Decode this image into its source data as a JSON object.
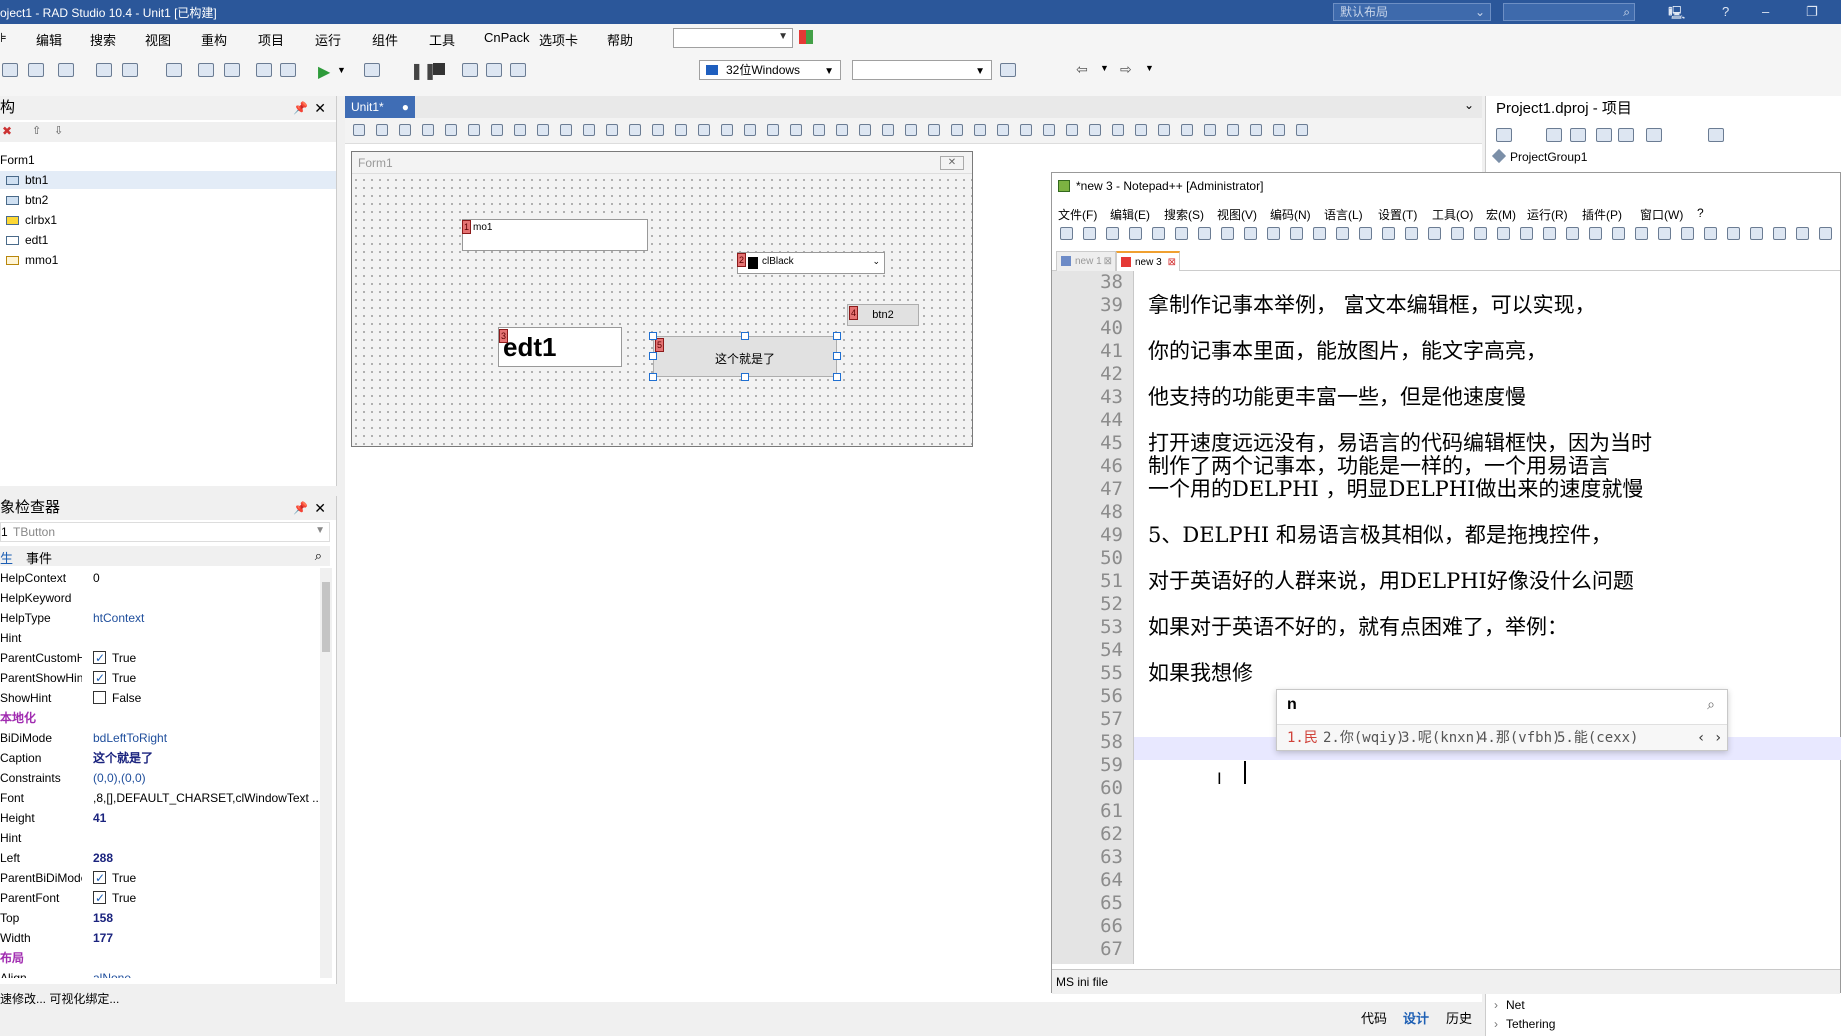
{
  "window": {
    "title": "oject1 - RAD Studio 10.4 - Unit1 [已构建]",
    "layout_label": "默认布局",
    "help_glyph": "?"
  },
  "menu": {
    "items": [
      "⊧",
      "编辑",
      "搜索",
      "视图",
      "重构",
      "项目",
      "运行",
      "组件",
      "工具",
      "CnPack",
      "选项卡",
      "帮助"
    ]
  },
  "toolbar": {
    "platform_label": "32位Windows"
  },
  "structure": {
    "title": "构",
    "items": [
      {
        "label": "Form1"
      },
      {
        "label": "btn1"
      },
      {
        "label": "btn2"
      },
      {
        "label": "clrbx1"
      },
      {
        "label": "edt1"
      },
      {
        "label": "mmo1"
      }
    ]
  },
  "inspector": {
    "title": "象检查器",
    "selected_name": "1",
    "selected_type": "TButton",
    "tab_properties": "生",
    "tab_events": "事件",
    "properties": [
      {
        "key": "HelpContext",
        "value": "0",
        "style": "plain"
      },
      {
        "key": "HelpKeyword",
        "value": "",
        "style": "plain"
      },
      {
        "key": "HelpType",
        "value": "htContext",
        "style": "blue"
      },
      {
        "key": "Hint",
        "value": "",
        "style": "plain"
      },
      {
        "key": "ParentCustomHi",
        "value": "True",
        "style": "check-on"
      },
      {
        "key": "ParentShowHint",
        "value": "True",
        "style": "check-on"
      },
      {
        "key": "ShowHint",
        "value": "False",
        "style": "check-off"
      },
      {
        "key": "本地化",
        "value": "",
        "style": "section"
      },
      {
        "key": "BiDiMode",
        "value": "bdLeftToRight",
        "style": "blue"
      },
      {
        "key": "Caption",
        "value": "这个就是了",
        "style": "bold"
      },
      {
        "key": "Constraints",
        "value": "(0,0),(0,0)",
        "style": "blue"
      },
      {
        "key": "Font",
        "value": ",8,[],DEFAULT_CHARSET,clWindowText ...",
        "style": "plain"
      },
      {
        "key": "Height",
        "value": "41",
        "style": "bold"
      },
      {
        "key": "Hint",
        "value": "",
        "style": "plain"
      },
      {
        "key": "Left",
        "value": "288",
        "style": "bold"
      },
      {
        "key": "ParentBiDiMode",
        "value": "True",
        "style": "check-on"
      },
      {
        "key": "ParentFont",
        "value": "True",
        "style": "check-on"
      },
      {
        "key": "Top",
        "value": "158",
        "style": "bold"
      },
      {
        "key": "Width",
        "value": "177",
        "style": "bold"
      },
      {
        "key": "布局",
        "value": "",
        "style": "section"
      },
      {
        "key": "Align",
        "value": "alNone",
        "style": "blue"
      }
    ],
    "status": "速修改... 可视化绑定..."
  },
  "designer": {
    "tab_label": "Unit1*",
    "form_caption": "Form1",
    "memo_text": "mo1",
    "colorbox_value": "clBlack",
    "edit_text": "edt1",
    "button1_caption": "这个就是了",
    "button2_caption": "btn2",
    "badges": [
      "1",
      "2",
      "3",
      "5",
      "4"
    ]
  },
  "notepad": {
    "title": "*new 3 - Notepad++ [Administrator]",
    "menu": [
      "文件(F)",
      "编辑(E)",
      "搜索(S)",
      "视图(V)",
      "编码(N)",
      "语言(L)",
      "设置(T)",
      "工具(O)",
      "宏(M)",
      "运行(R)",
      "插件(P)",
      "窗口(W)",
      "?"
    ],
    "tabs": [
      "new 1",
      "new 3"
    ],
    "line_numbers": [
      "38",
      "39",
      "40",
      "41",
      "42",
      "43",
      "44",
      "45",
      "46",
      "47",
      "48",
      "49",
      "50",
      "51",
      "52",
      "53",
      "54",
      "55",
      "56",
      "57",
      "58",
      "59",
      "60",
      "61",
      "62",
      "63",
      "64",
      "65",
      "66",
      "67"
    ],
    "lines": [
      "",
      "拿制作记事本举例， 富文本编辑框，可以实现，",
      "",
      "你的记事本里面，能放图片，能文字高亮，",
      "",
      "他支持的功能更丰富一些，但是他速度慢",
      "",
      "打开速度远远没有，易语言的代码编辑框快，因为当时",
      "制作了两个记事本，功能是一样的，一个用易语言",
      "一个用的DELPHI ，明显DELPHI做出来的速度就慢",
      "",
      "5、DELPHI 和易语言极其相似，都是拖拽控件，",
      "",
      "对于英语好的人群来说，用DELPHI好像没什么问题",
      "",
      "如果对于英语不好的，就有点困难了，举例：",
      "",
      "如果我想修"
    ],
    "status": "MS ini file"
  },
  "ime": {
    "input": "n",
    "candidates": [
      "1.民",
      "2.你(wqiy)",
      "3.呢(knxn)",
      "4.那(vfbh)",
      "5.能(cexx)"
    ],
    "nav": "‹ ›"
  },
  "project": {
    "title": "Project1.dproj - 项目",
    "root": "ProjectGroup1",
    "bottom_items": [
      "Net",
      "Tethering"
    ]
  },
  "bottom_tabs": [
    "代码",
    "设计",
    "历史"
  ]
}
